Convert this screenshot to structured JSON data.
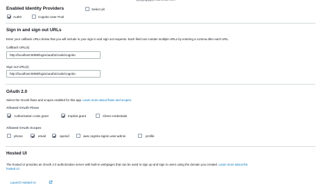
{
  "top_text": "Signing user (hidden)",
  "identity": {
    "heading": "Enabled Identity Providers",
    "select_all": "Select all",
    "providers": [
      {
        "label": "Auth0",
        "checked": true
      },
      {
        "label": "Cognito User Pool",
        "checked": false
      }
    ]
  },
  "sign_urls": {
    "heading": "Sign in and sign out URLs",
    "description": "Enter your callback URLs below that you will include in your sign in and sign out requests. Each field can contain multiple URLs by entering a comma after each URL.",
    "callback_label": "Callback URL(s)",
    "callback_value": "http://localhost:8089/login/oauth2/code/cognito",
    "signout_label": "Sign out URL(s)",
    "signout_value": "http://localhost:8089/login/oauth2/code/cognito"
  },
  "oauth": {
    "heading": "OAuth 2.0",
    "description_prefix": "Select the OAuth flows and scopes enabled for this app.",
    "description_link": "Learn more about flows and scopes.",
    "flows_label": "Allowed OAuth Flows",
    "flows": [
      {
        "label": "Authorization code grant",
        "checked": true
      },
      {
        "label": "Implicit grant",
        "checked": true
      },
      {
        "label": "Client credentials",
        "checked": false
      }
    ],
    "scopes_label": "Allowed OAuth Scopes",
    "scopes": [
      {
        "label": "phone",
        "checked": false
      },
      {
        "label": "email",
        "checked": true
      },
      {
        "label": "openid",
        "checked": true
      },
      {
        "label": "aws.cognito.signin.user.admin",
        "checked": false
      },
      {
        "label": "profile",
        "checked": false
      }
    ]
  },
  "hosted_ui": {
    "heading": "Hosted UI",
    "description_line1": "The hosted UI provides an OAuth 2.0 authorization server with built-in webpages that can be used to sign up and sign in users using the domain you created.",
    "link_part1": "Learn more about the",
    "link_part2": "hosted UI",
    "launch_label": "Launch Hosted UI"
  }
}
